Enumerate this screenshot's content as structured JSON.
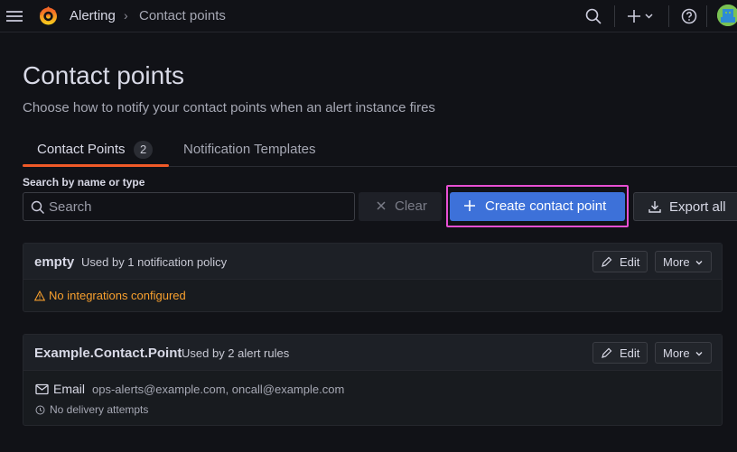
{
  "topbar": {
    "breadcrumb_root": "Alerting",
    "breadcrumb_separator": "›",
    "breadcrumb_current": "Contact points",
    "icons": [
      "menu-icon",
      "grafana-logo",
      "search-icon",
      "plus-icon",
      "help-icon",
      "user-avatar"
    ]
  },
  "page": {
    "title": "Contact points",
    "subtitle": "Choose how to notify your contact points when an alert instance fires"
  },
  "tabs": [
    {
      "label": "Contact Points",
      "count": "2",
      "active": true
    },
    {
      "label": "Notification Templates",
      "active": false
    }
  ],
  "toolbar": {
    "search_label": "Search by name or type",
    "search_placeholder": "Search",
    "search_value": "",
    "clear_label": "Clear",
    "create_label": "Create contact point",
    "export_label": "Export all"
  },
  "contact_points": [
    {
      "name": "empty",
      "usage": "Used by 1 notification policy",
      "edit_label": "Edit",
      "more_label": "More",
      "warning": "No integrations configured"
    },
    {
      "name": "Example.Contact.Point",
      "usage": "Used by 2 alert rules",
      "edit_label": "Edit",
      "more_label": "More",
      "integration_type": "Email",
      "integration_addresses": "ops-alerts@example.com, oncall@example.com",
      "delivery_status": "No delivery attempts"
    }
  ],
  "colors": {
    "background": "#111217",
    "accent_tab": "#f05a28",
    "primary_button": "#3d71d9",
    "warning": "#f8a02e",
    "highlight_outline": "#e84fd3"
  }
}
